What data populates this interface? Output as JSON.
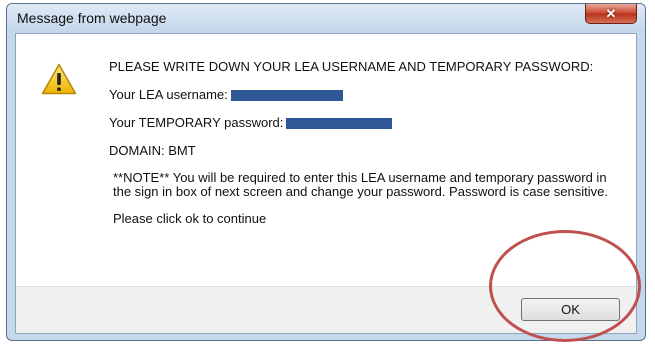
{
  "dialog": {
    "title": "Message from webpage",
    "close_glyph": "✕",
    "icon": "warning-icon",
    "headline": "PLEASE WRITE DOWN YOUR LEA USERNAME AND TEMPORARY PASSWORD:",
    "username_label": "Your LEA username:",
    "password_label": "Your TEMPORARY password:",
    "domain_line": "DOMAIN: BMT",
    "note": "**NOTE** You will be required to enter this LEA username and temporary password in the sign in box of next screen and change your password. Password is case sensitive.",
    "continue_text": "Please click ok to continue",
    "ok_label": "OK"
  },
  "colors": {
    "redaction": "#2f5795",
    "annotation_circle": "#c0504d",
    "close_button": "#c9452a"
  }
}
